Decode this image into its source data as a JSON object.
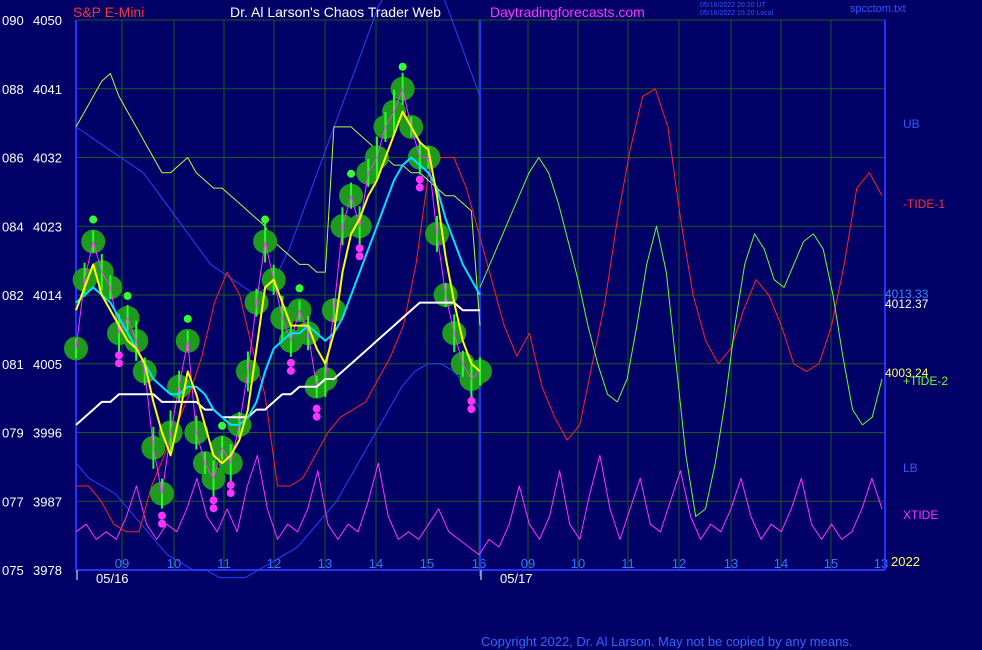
{
  "header": {
    "symbol": "S&P E-Mini",
    "title": "Dr. Al Larson's Chaos Trader Web",
    "site": "Daytradingforecasts.com",
    "stamp_ut": "05/16/2022 20:20 UT",
    "stamp_local": "05/16/2022 15:20 Local",
    "file": "spcctom.txt"
  },
  "copyright": "Copyright 2022, Dr. Al Larson. May not be copied by any means.",
  "colors": {
    "background": "#000066",
    "grid": "#1a5a1a",
    "axis": "#2233ff",
    "band": "#2244ff",
    "tide1": "#ff2020",
    "tide2": "#66ff33",
    "xtide": "#ff33ff",
    "ma_slow": "#ffffff",
    "ma_mid": "#00e0ff",
    "ma_fast": "#ffff00",
    "ma_long": "#b0ff40",
    "bars": "#22ff22",
    "halo": "#1f9a1f",
    "up_dot": "#33ff33",
    "down_dot": "#ff33ff"
  },
  "chart_data": {
    "type": "line",
    "y_axis": {
      "ticks": [
        {
          "code": "090",
          "price": "4050"
        },
        {
          "code": "088",
          "price": "4041"
        },
        {
          "code": "086",
          "price": "4032"
        },
        {
          "code": "084",
          "price": "4023"
        },
        {
          "code": "082",
          "price": "4014"
        },
        {
          "code": "081",
          "price": "4005"
        },
        {
          "code": "079",
          "price": "3996"
        },
        {
          "code": "077",
          "price": "3987"
        },
        {
          "code": "075",
          "price": "3978"
        }
      ],
      "ylim": [
        3978,
        4050
      ]
    },
    "x_axis": {
      "hours": [
        "09",
        "10",
        "11",
        "12",
        "13",
        "14",
        "15",
        "16",
        "09",
        "10",
        "11",
        "12",
        "13",
        "14",
        "15",
        "13"
      ],
      "dates": [
        "05/16",
        "05/17"
      ],
      "year": "2022"
    },
    "right_labels": [
      {
        "text": "UB",
        "color": "#3355ff"
      },
      {
        "text": "-TIDE-1",
        "color": "#ff3030"
      },
      {
        "text": "4013.33",
        "color": "#3388ff"
      },
      {
        "text": "4012.37",
        "color": "#ffffff"
      },
      {
        "text": "4003.24",
        "color": "#ffff66"
      },
      {
        "text": "+TIDE-2",
        "color": "#66ff33"
      },
      {
        "text": "LB",
        "color": "#3355ff"
      },
      {
        "text": "XTIDE",
        "color": "#ff33ff"
      }
    ],
    "series": {
      "price": [
        4007,
        4016,
        4021,
        4017,
        4015,
        4009,
        4011,
        4008,
        4004,
        3994,
        3988,
        3996,
        4002,
        4008,
        3996,
        3992,
        3990,
        3994,
        3992,
        3997,
        4004,
        4013,
        4021,
        4016,
        4011,
        4008,
        4012,
        4009,
        4002,
        4003,
        4012,
        4023,
        4027,
        4023,
        4030,
        4032,
        4036,
        4038,
        4041,
        4036,
        4032,
        4032,
        4022,
        4014,
        4009,
        4005,
        4003,
        4004
      ],
      "ma_fast": [
        4012,
        4015,
        4018,
        4014,
        4012,
        4010,
        4008,
        4007,
        4005,
        4000,
        3996,
        3993,
        3998,
        4004,
        4001,
        3997,
        3993,
        3992,
        3993,
        3995,
        3999,
        4007,
        4015,
        4016,
        4013,
        4010,
        4010,
        4010,
        4007,
        4005,
        4009,
        4017,
        4022,
        4024,
        4027,
        4029,
        4032,
        4035,
        4038,
        4036,
        4034,
        4033,
        4027,
        4019,
        4013,
        4008,
        4005,
        4004
      ],
      "ma_mid": [
        4013,
        4014,
        4015,
        4014,
        4013,
        4011,
        4009,
        4007,
        4005,
        4003,
        4002,
        4001,
        4001,
        4002,
        4002,
        4001,
        3999,
        3998,
        3997,
        3997,
        3998,
        4000,
        4004,
        4007,
        4008,
        4009,
        4009,
        4010,
        4009,
        4008,
        4009,
        4011,
        4014,
        4017,
        4020,
        4023,
        4026,
        4029,
        4031,
        4032,
        4031,
        4030,
        4028,
        4024,
        4021,
        4018,
        4016,
        4014
      ],
      "ma_slow": [
        3997,
        3998,
        3999,
        4000,
        4000,
        4001,
        4001,
        4001,
        4001,
        4001,
        4000,
        4000,
        4000,
        4000,
        4000,
        3999,
        3999,
        3998,
        3998,
        3998,
        3998,
        3999,
        3999,
        4000,
        4001,
        4001,
        4002,
        4002,
        4002,
        4003,
        4003,
        4004,
        4005,
        4006,
        4007,
        4008,
        4009,
        4010,
        4011,
        4012,
        4013,
        4013,
        4013,
        4013,
        4013,
        4012,
        4012,
        4012
      ],
      "ma_long": [
        4036,
        4038,
        4040,
        4042,
        4043,
        4040,
        4038,
        4036,
        4034,
        4032,
        4030,
        4030,
        4031,
        4032,
        4030,
        4029,
        4028,
        4028,
        4027,
        4026,
        4025,
        4024,
        4023,
        4021,
        4020,
        4019,
        4018,
        4018,
        4017,
        4017,
        4036,
        4036,
        4036,
        4035,
        4034,
        4033,
        4032,
        4031,
        4031,
        4030,
        4030,
        4029,
        4028,
        4027,
        4027,
        4026,
        4025,
        4010
      ],
      "upper_band": [
        4036,
        4035,
        4034,
        4033,
        4032,
        4031,
        4030,
        4028,
        4026,
        4024,
        4022,
        4020,
        4018,
        4017,
        4016,
        4015,
        4014,
        4015,
        4017,
        4020,
        4024,
        4028,
        4032,
        4036,
        4040,
        4044,
        4048,
        4052,
        4054,
        4056,
        4058,
        4058,
        4056,
        4052,
        4048,
        4044,
        4040
      ],
      "lower_band": [
        3992,
        3990,
        3989,
        3988,
        3986,
        3984,
        3982,
        3980,
        3979,
        3978,
        3978,
        3977,
        3977,
        3977,
        3978,
        3979,
        3980,
        3981,
        3983,
        3985,
        3987,
        3990,
        3993,
        3996,
        3999,
        4002,
        4004,
        4005,
        4005,
        4004,
        4002,
        3999
      ],
      "tide1": [
        3989,
        3989,
        3987,
        3984,
        3983,
        3983,
        3989,
        3993,
        3997,
        4001,
        4006,
        4013,
        4017,
        4014,
        4007,
        4001,
        3989,
        3989,
        3990,
        3993,
        3996,
        3998,
        3999,
        4000,
        4003,
        4006,
        4010,
        4018,
        4030,
        4032,
        4032,
        4028,
        4022,
        4016,
        4010,
        4006,
        4009,
        4002,
        3998,
        3995,
        3997,
        4005,
        4013,
        4024,
        4033,
        4040,
        4041,
        4036,
        4024,
        4014,
        4008,
        4005,
        4007,
        4012,
        4016,
        4014,
        4010,
        4005,
        4004,
        4005,
        4010,
        4018,
        4028,
        4030,
        4027
      ],
      "tide2": [
        4015,
        4018,
        4021,
        4024,
        4027,
        4030,
        4032,
        4030,
        4026,
        4021,
        4016,
        4010,
        4005,
        4001,
        4000,
        4003,
        4010,
        4018,
        4023,
        4017,
        4005,
        3993,
        3985,
        3986,
        3992,
        4000,
        4010,
        4018,
        4022,
        4020,
        4016,
        4015,
        4018,
        4021,
        4022,
        4020,
        4014,
        4006,
        3999,
        3997,
        3998,
        4003
      ],
      "xtide": [
        3983,
        3984,
        3982,
        3983,
        3982,
        3985,
        3989,
        3984,
        3982,
        3984,
        3983,
        3986,
        3990,
        3985,
        3983,
        3986,
        3983,
        3989,
        3993,
        3986,
        3982,
        3984,
        3983,
        3986,
        3991,
        3984,
        3982,
        3984,
        3983,
        3987,
        3992,
        3985,
        3982,
        3983,
        3982,
        3984,
        3986,
        3983,
        3982,
        3981,
        3980,
        3982,
        3981,
        3984,
        3989,
        3984,
        3982,
        3985,
        3991,
        3984,
        3982,
        3988,
        3993,
        3986,
        3982,
        3986,
        3990,
        3984,
        3983,
        3987,
        3991,
        3985,
        3982,
        3984,
        3983,
        3986,
        3990,
        3985,
        3982,
        3984,
        3983,
        3986,
        3990,
        3984,
        3982,
        3984,
        3982,
        3983,
        3986,
        3990,
        3986
      ]
    }
  }
}
